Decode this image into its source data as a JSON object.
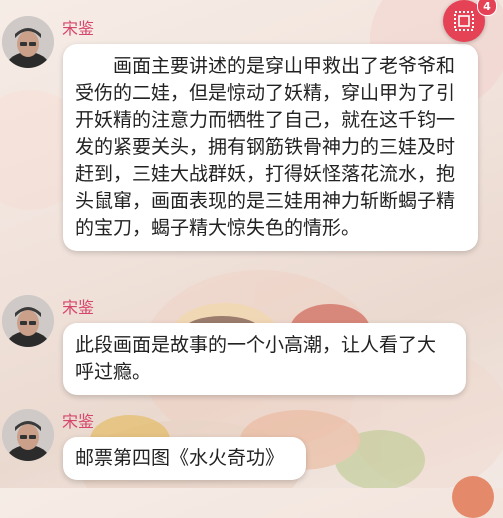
{
  "messages": [
    {
      "author": "宋鉴",
      "text": "画面主要讲述的是穿山甲救出了老爷爷和受伤的二娃，但是惊动了妖精，穿山甲为了引开妖精的注意力而牺牲了自己，就在这千钧一发的紧要关头，拥有钢筋铁骨神力的三娃及时赶到，三娃大战群妖，打得妖怪落花流水，抱头鼠窜，画面表现的是三娃用神力斩断蝎子精的宝刀，蝎子精大惊失色的情形。"
    },
    {
      "author": "宋鉴",
      "text": "此段画面是故事的一个小高潮，让人看了大呼过瘾。"
    },
    {
      "author": "宋鉴",
      "text": "邮票第四图《水火奇功》"
    }
  ],
  "stamp_button": {
    "icon": "stamp-icon",
    "badge_count": "4",
    "color": "#e64256"
  }
}
